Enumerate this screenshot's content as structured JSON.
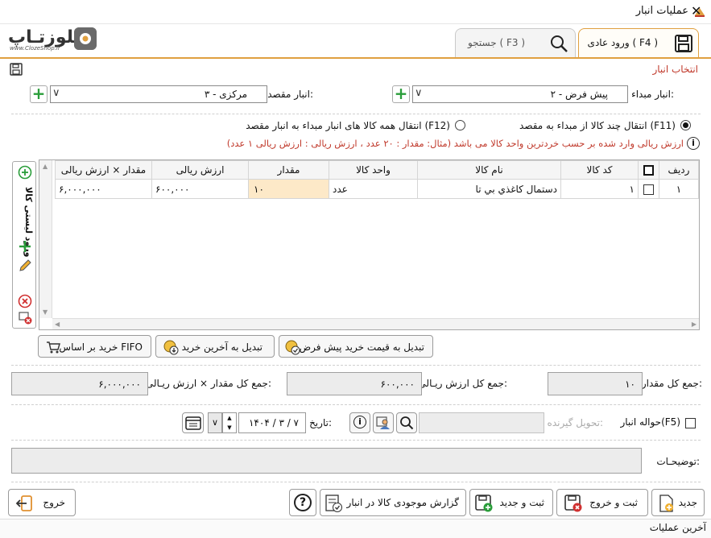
{
  "window": {
    "title": "عملیات انبار"
  },
  "logo": {
    "text": "کلوزتـاپ",
    "sub": "www.ClozeShop.ir"
  },
  "tabs": [
    {
      "label": "ورود عادی ( F4 )"
    },
    {
      "label": "جستجو ( F3 )"
    }
  ],
  "section": {
    "title": "انتخاب انبار"
  },
  "source": {
    "label": "انبار مبداء:",
    "value": "پیش فرض - ۲"
  },
  "dest": {
    "label": "انبار مقصد:",
    "value": "مرکزی - ۳"
  },
  "radios": {
    "multi": "انتقال چند کالا از مبداء به مقصد (F11)",
    "all": "انتقال همه کالا های انبار مبداء به انبار مقصد (F12)"
  },
  "hint": "ارزش ریالی  وارد شده بر حسب خردترین واحد کالا می باشد (مثال:  مقدار : ۲۰ عدد  ،  ارزش ریالی : ارزش ریالی ۱ عدد)",
  "grid": {
    "headers": [
      "ردیف",
      "",
      "کد کالا",
      "نام کالا",
      "واحد کالا",
      "مقدار",
      "ارزش ریالی",
      "مقدار × ارزش ریالی"
    ],
    "rows": [
      {
        "row": "۱",
        "code": "۱",
        "name": "دستمال کاغذي بي تا",
        "unit": "عدد",
        "qty": "۱۰",
        "price": "۶۰۰,۰۰۰",
        "total": "۶,۰۰۰,۰۰۰"
      }
    ]
  },
  "sidebar": {
    "label": "ورود لیستی کالا"
  },
  "price_buttons": {
    "default": "تبدیل به قیمت خرید پیش فرض",
    "last": "تبدیل به آخرین خرید",
    "fifo": "خرید بر اساس FIFO"
  },
  "totals": {
    "qty_label": "جمع کل مقدار:",
    "qty_value": "۱۰",
    "value_label": "جمع کل ارزش ریـالی:",
    "value_value": "۶۰۰,۰۰۰",
    "grand_label": "جمع کل مقدار × ارزش ریـالی:",
    "grand_value": "۶,۰۰۰,۰۰۰"
  },
  "havale": {
    "label": "حواله انبار(F5)",
    "receiver_label": "تحویل گیرنده:",
    "date_label": "تاریخ:",
    "date_value": "۱۴۰۴ / ۳ / ۷"
  },
  "notes": {
    "label": "توضیحـات:"
  },
  "buttons": {
    "new": "جدید",
    "save_exit": "ثبت و خروج",
    "save_new": "ثبت و جدید",
    "report": "گزارش موجودی کالا در انبار",
    "exit": "خروج"
  },
  "status": {
    "text": "آخرین عملیات"
  },
  "colors": {
    "accent": "#e0a040",
    "hint": "#c0392b",
    "plus": "#2a9d3a",
    "qty_cell": "#fde9c8"
  }
}
